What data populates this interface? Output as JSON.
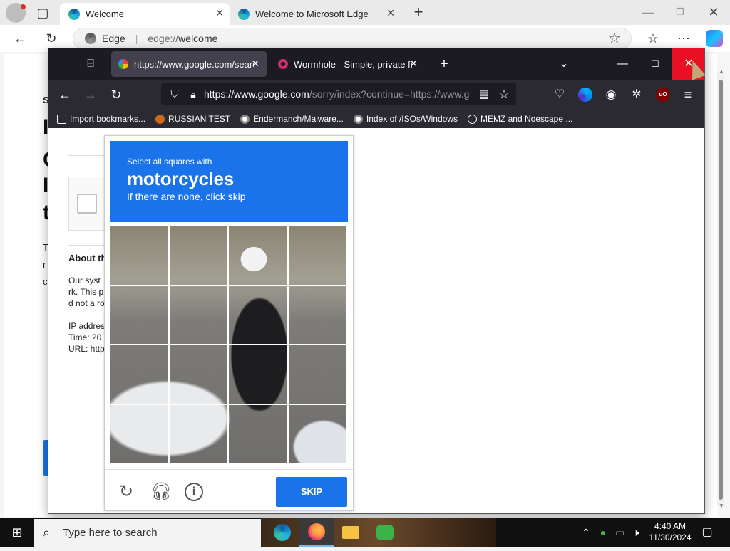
{
  "edge": {
    "tabs": [
      {
        "label": "Welcome"
      },
      {
        "label": "Welcome to Microsoft Edge"
      }
    ],
    "address": {
      "prefix": "Edge",
      "separator": "|",
      "url_prefix": "edge://",
      "url_host": "welcome"
    },
    "page_fragments": {
      "letters": [
        "S",
        "I",
        "C",
        "I",
        "t",
        "T",
        "r",
        "c"
      ],
      "about_heading": "About th",
      "body_line1": "Our syst",
      "body_line2": "rk. This p",
      "body_line3": "d not a ro",
      "ip": "IP addres",
      "time": "Time: 20",
      "url": "URL: http"
    }
  },
  "firefox": {
    "tabs": [
      {
        "label": "https://www.google.com/search"
      },
      {
        "label": "Wormhole - Simple, private file"
      }
    ],
    "url": {
      "host": "https://www.google.com",
      "path": "/sorry/index?continue=https://www.g"
    },
    "bookmarks": [
      {
        "label": "Import bookmarks..."
      },
      {
        "label": "RUSSIAN TEST"
      },
      {
        "label": "Endermanch/Malware..."
      },
      {
        "label": "Index of /ISOs/Windows"
      },
      {
        "label": "MEMZ and Noescape ..."
      }
    ],
    "ublock_badge": "uO"
  },
  "captcha": {
    "line1": "Select all squares with",
    "target": "motorcycles",
    "line3": "If there are none, click skip",
    "skip_label": "SKIP",
    "grid_size": 4
  },
  "taskbar": {
    "search_placeholder": "Type here to search",
    "time": "4:40 AM",
    "date": "11/30/2024"
  },
  "colors": {
    "captcha_blue": "#1a73e8",
    "firefox_dark": "#1c1b22",
    "close_red": "#e81123"
  }
}
